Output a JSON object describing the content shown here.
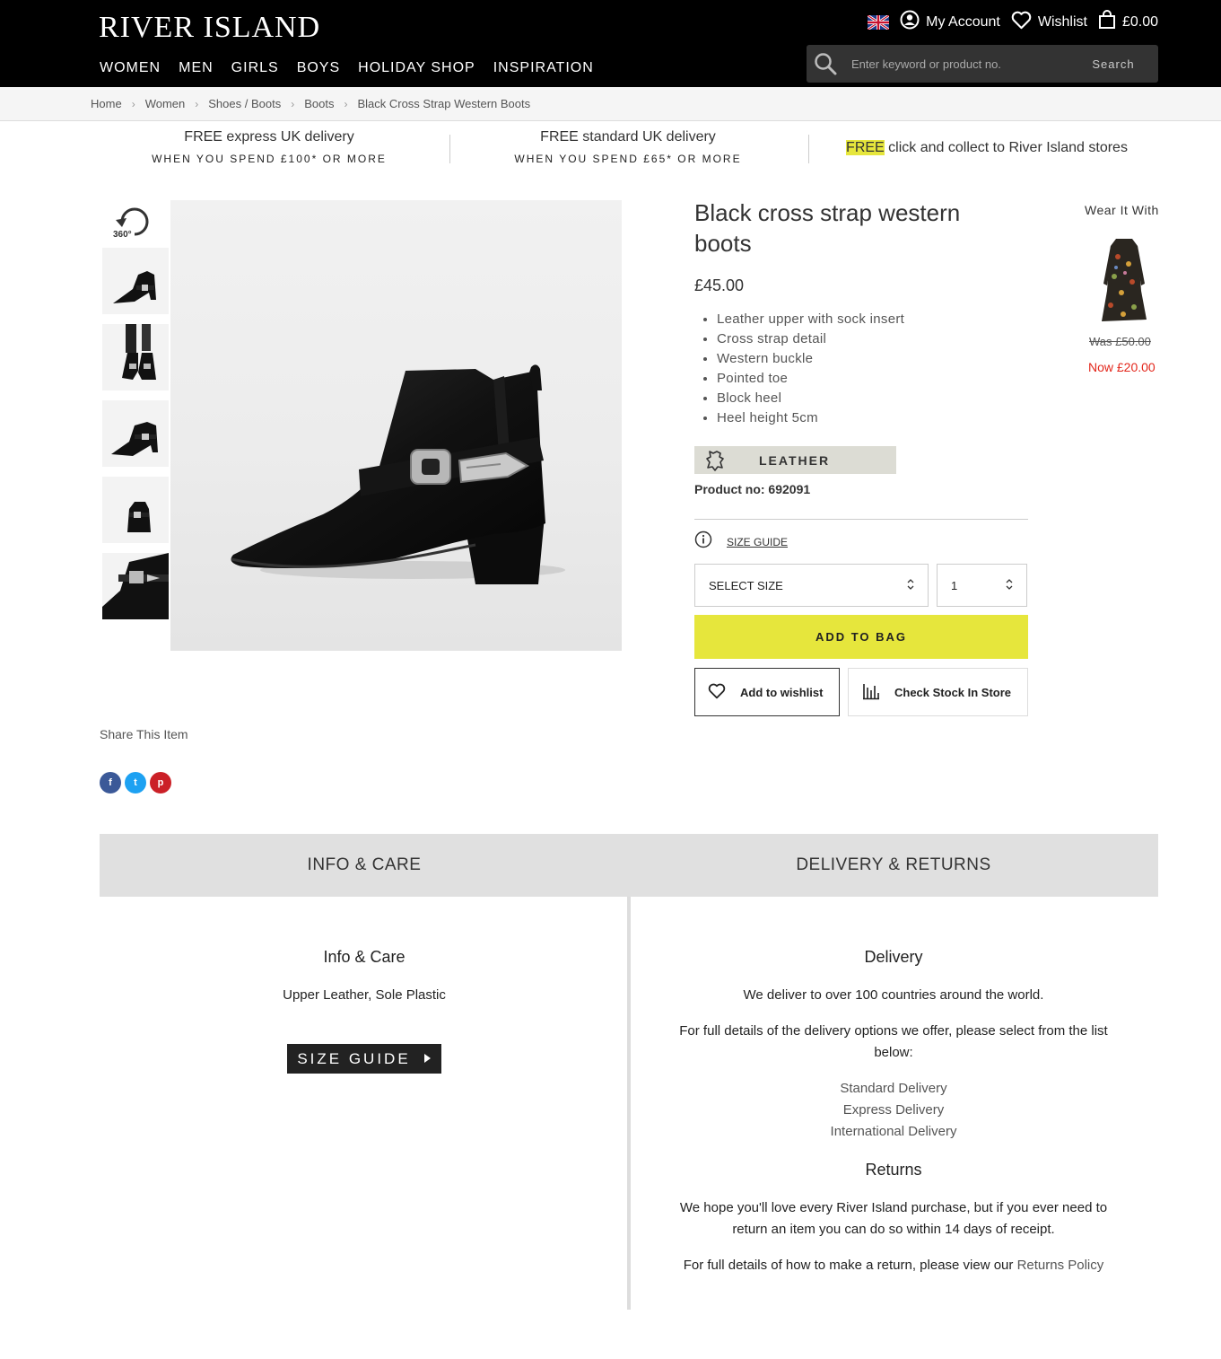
{
  "header": {
    "logo": "RIVER ISLAND",
    "account_label": "My Account",
    "wishlist_label": "Wishlist",
    "bag_total": "£0.00",
    "nav": [
      "WOMEN",
      "MEN",
      "GIRLS",
      "BOYS",
      "HOLIDAY SHOP",
      "INSPIRATION"
    ],
    "search_placeholder": "Enter keyword or product no.",
    "search_button": "Search"
  },
  "breadcrumb": [
    "Home",
    "Women",
    "Shoes / Boots",
    "Boots",
    "Black Cross Strap Western Boots"
  ],
  "promos": [
    {
      "title": "FREE express UK delivery",
      "sub": "WHEN YOU SPEND £100* OR MORE"
    },
    {
      "title": "FREE standard UK delivery",
      "sub": "WHEN YOU SPEND £65* OR MORE"
    },
    {
      "highlight": "FREE",
      "title": " click and collect to River Island stores"
    }
  ],
  "gallery": {
    "rotate_label": "360°"
  },
  "product": {
    "title": "Black cross strap western boots",
    "price": "£45.00",
    "features": [
      "Leather upper with sock insert",
      "Cross strap detail",
      "Western buckle",
      "Pointed toe",
      "Block heel",
      "Heel height 5cm"
    ],
    "badge": "LEATHER",
    "product_no": "Product no: 692091",
    "size_guide": "SIZE GUIDE",
    "select_size": "SELECT SIZE",
    "quantity": "1",
    "add_to_bag": "ADD TO BAG",
    "add_to_wishlist": "Add to wishlist",
    "check_stock": "Check Stock In Store"
  },
  "wear_it_with": {
    "title": "Wear It With",
    "was": "Was £50.00",
    "now": "Now £20.00"
  },
  "share": {
    "title": "Share This Item",
    "facebook": "f",
    "twitter": "t",
    "pinterest": "p"
  },
  "tabs": [
    "INFO & CARE",
    "DELIVERY & RETURNS"
  ],
  "info_care": {
    "heading": "Info & Care",
    "text": "Upper Leather, Sole Plastic",
    "button": "SIZE GUIDE"
  },
  "delivery": {
    "heading": "Delivery",
    "p1": "We deliver to over 100 countries around the world.",
    "p2": "For full details of the delivery options we offer, please select from the list below:",
    "links": [
      "Standard Delivery",
      "Express Delivery",
      "International Delivery"
    ]
  },
  "returns": {
    "heading": "Returns",
    "p1": "We hope you'll love every River Island purchase, but if you ever need to return an item you can do so within 14 days of receipt.",
    "p2": "For full details of how to make a return, please view our ",
    "link": "Returns Policy"
  },
  "colors": {
    "accent_yellow": "#e6e63c",
    "sale_red": "#e3261b",
    "header_bg": "#000000"
  }
}
